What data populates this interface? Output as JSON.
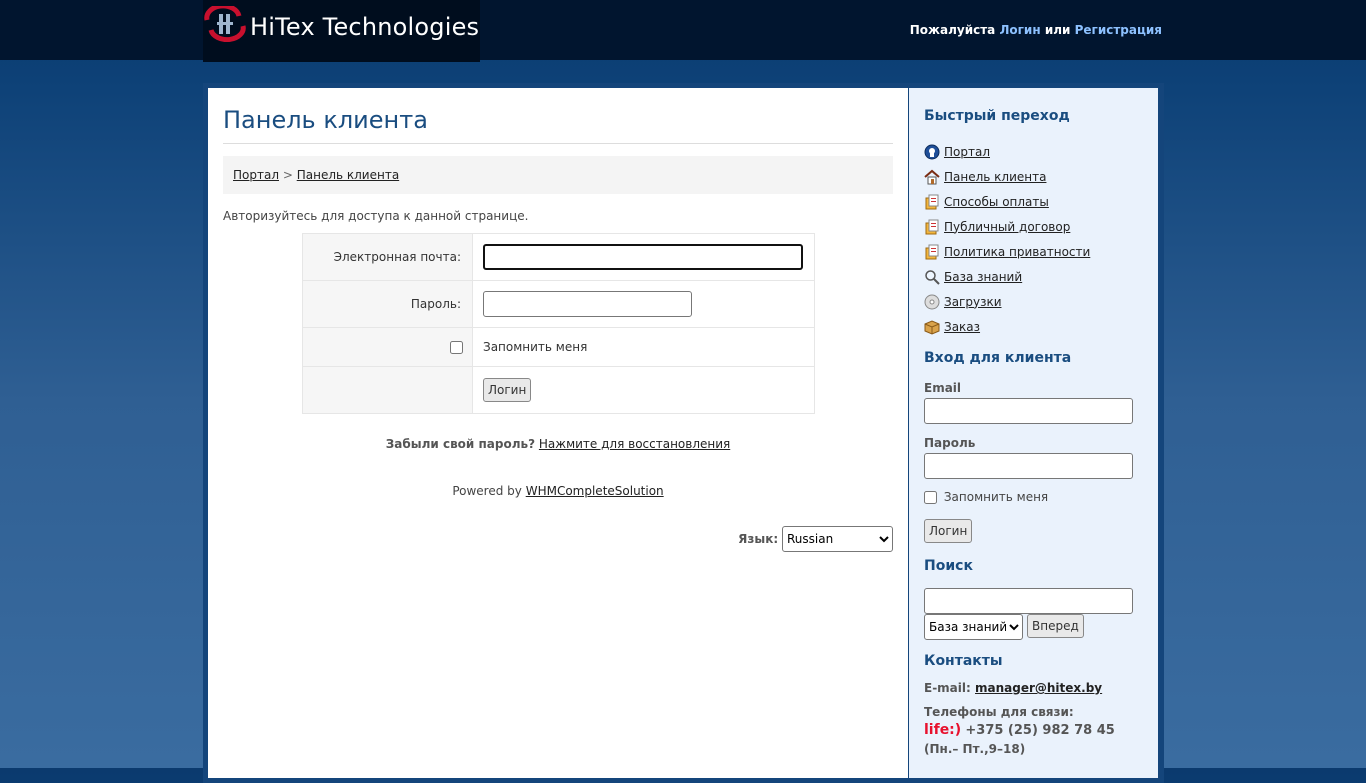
{
  "header": {
    "brand": "HiTex Technologies",
    "prompt_prefix": "Пожалуйста",
    "login_link": "Логин",
    "or_text": "или",
    "register_link": "Регистрация"
  },
  "main": {
    "title": "Панель клиента",
    "breadcrumb": {
      "portal": "Портал",
      "separator": ">",
      "current": "Панель клиента"
    },
    "intro": "Авторизуйтесь для доступа к данной странице.",
    "form": {
      "email_label": "Электронная почта:",
      "email_value": "",
      "password_label": "Пароль:",
      "password_value": "",
      "remember_label": "Запомнить меня",
      "remember_checked": false,
      "submit_label": "Логин"
    },
    "forgot_text": "Забыли свой пароль?",
    "forgot_link": "Нажмите для восстановления",
    "powered_prefix": "Powered by",
    "powered_link": "WHMCompleteSolution",
    "language_label": "Язык:",
    "language_selected": "Russian"
  },
  "sidebar": {
    "quick_heading": "Быстрый переход",
    "quick_links": [
      {
        "label": "Портал",
        "icon": "globe-icon"
      },
      {
        "label": "Панель клиента",
        "icon": "home-icon"
      },
      {
        "label": "Способы оплаты",
        "icon": "document-icon"
      },
      {
        "label": "Публичный договор",
        "icon": "document-icon"
      },
      {
        "label": "Политика приватности",
        "icon": "document-icon"
      },
      {
        "label": "База знаний",
        "icon": "magnifier-icon"
      },
      {
        "label": "Загрузки",
        "icon": "disc-icon"
      },
      {
        "label": "Заказ",
        "icon": "box-icon"
      }
    ],
    "login_heading": "Вход для клиента",
    "email_label": "Email",
    "password_label": "Пароль",
    "remember_label": "Запомнить меня",
    "login_button": "Логин",
    "search_heading": "Поиск",
    "search_value": "",
    "search_scope": "База знаний",
    "search_button": "Вперед",
    "contacts_heading": "Контакты",
    "email_prefix": "E-mail:",
    "email_address": "manager@hitex.by",
    "phones_label": "Телефоны для связи:",
    "operator_logo": "life:)",
    "phone": "+375 (25) 982 78 45",
    "hours": "(Пн.– Пт.,9–18)"
  },
  "colors": {
    "header_bg": "#01152f",
    "accent_link": "#8dc1ff",
    "heading": "#1a4d80",
    "sidebar_bg": "#eaf2fc"
  }
}
